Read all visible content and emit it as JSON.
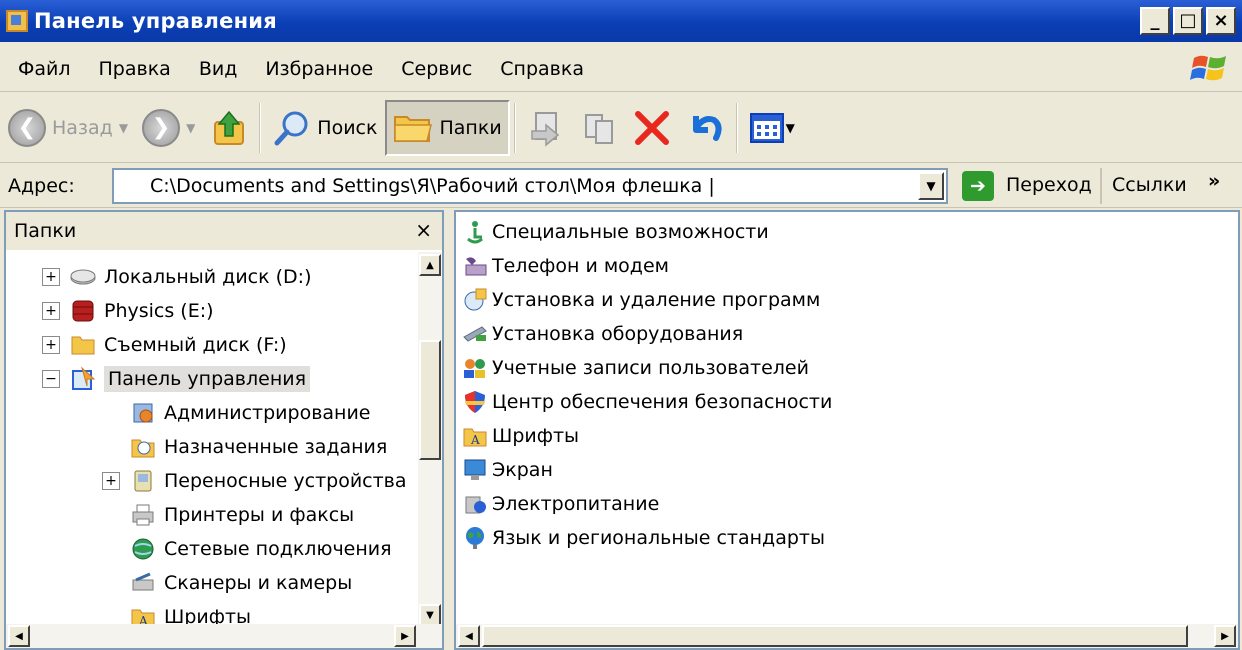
{
  "window": {
    "title": "Панель управления",
    "buttons": {
      "minimize": "_",
      "maximize": "□",
      "close": "×"
    }
  },
  "menu": [
    "Файл",
    "Правка",
    "Вид",
    "Избранное",
    "Сервис",
    "Справка"
  ],
  "toolbar": {
    "back": "Назад",
    "search": "Поиск",
    "folders": "Папки"
  },
  "address": {
    "label": "Адрес:",
    "value": "C:\\Documents and Settings\\Я\\Рабочий стол\\Моя флешка |",
    "go": "Переход",
    "links": "Ссылки",
    "links_chevron": "»"
  },
  "left_pane": {
    "title": "Папки",
    "close": "×",
    "tree": [
      {
        "label": "Локальный диск (D:)",
        "expander": "+",
        "icon": "disk-icon"
      },
      {
        "label": "Physics (E:)",
        "expander": "+",
        "icon": "physics-drive-icon"
      },
      {
        "label": "Съемный диск (F:)",
        "expander": "+",
        "icon": "folder-icon"
      },
      {
        "label": "Панель управления",
        "expander": "−",
        "icon": "control-panel-icon",
        "selected": true
      },
      {
        "label": "Администрирование",
        "icon": "admin-tools-icon"
      },
      {
        "label": "Назначенные задания",
        "icon": "scheduled-tasks-icon"
      },
      {
        "label": "Переносные устройства",
        "expander": "+",
        "icon": "portable-devices-icon"
      },
      {
        "label": "Принтеры и факсы",
        "icon": "printer-icon"
      },
      {
        "label": "Сетевые подключения",
        "icon": "network-icon"
      },
      {
        "label": "Сканеры и камеры",
        "icon": "scanner-icon"
      },
      {
        "label": "Шрифты",
        "icon": "fonts-folder-icon"
      }
    ]
  },
  "right_pane": {
    "items": [
      "Специальные возможности",
      "Телефон и модем",
      "Установка и удаление программ",
      "Установка оборудования",
      "Учетные записи пользователей",
      "Центр обеспечения безопасности",
      "Шрифты",
      "Экран",
      "Электропитание",
      "Язык и региональные стандарты"
    ]
  }
}
